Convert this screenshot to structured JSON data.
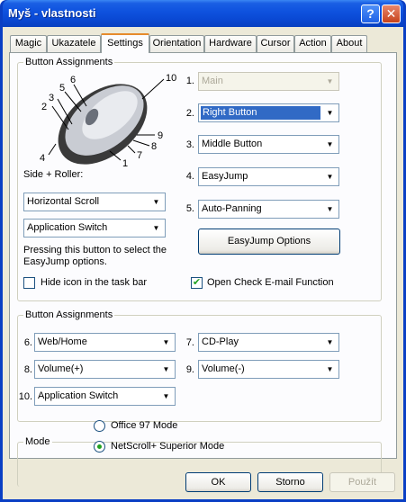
{
  "window": {
    "title": "Myš - vlastnosti",
    "help": "?",
    "close": "✕"
  },
  "tabs": [
    "Magic",
    "Ukazatele",
    "Settings",
    "Orientation",
    "Hardware",
    "Cursor",
    "Action",
    "About"
  ],
  "group1": {
    "legend": "Button  Assignments",
    "callouts": [
      "10",
      "6",
      "5",
      "3",
      "2",
      "4",
      "9",
      "8",
      "7",
      "1"
    ],
    "side_roller_label": "Side + Roller:",
    "side_combo1": "Horizontal Scroll",
    "side_combo2": "Application Switch",
    "hint": "Pressing this button to select the EasyJump options.",
    "assignments": [
      {
        "num": "1.",
        "value": "Main"
      },
      {
        "num": "2.",
        "value": "Right Button"
      },
      {
        "num": "3.",
        "value": "Middle Button"
      },
      {
        "num": "4.",
        "value": "EasyJump"
      },
      {
        "num": "5.",
        "value": "Auto-Panning"
      }
    ],
    "easyjump_button": "EasyJump Options",
    "hide_icon_label": "Hide icon in the task bar",
    "open_check_label": "Open Check E-mail Function"
  },
  "group2": {
    "legend": "Button  Assignments",
    "items": [
      {
        "num": "6.",
        "value": "Web/Home"
      },
      {
        "num": "7.",
        "value": "CD-Play"
      },
      {
        "num": "8.",
        "value": "Volume(+)"
      },
      {
        "num": "9.",
        "value": "Volume(-)"
      },
      {
        "num": "10.",
        "value": "Application Switch"
      }
    ]
  },
  "mode": {
    "legend": "Mode",
    "option1": "Office 97 Mode",
    "option2": "NetScroll+ Superior Mode"
  },
  "footer": {
    "ok": "OK",
    "cancel": "Storno",
    "apply": "Použít"
  },
  "icons": {
    "dropdown": "▼",
    "check": "✔"
  },
  "colors": {
    "titlebar": "#0a49d4",
    "accent_tab": "#e68b2c",
    "selection": "#316ac5"
  }
}
